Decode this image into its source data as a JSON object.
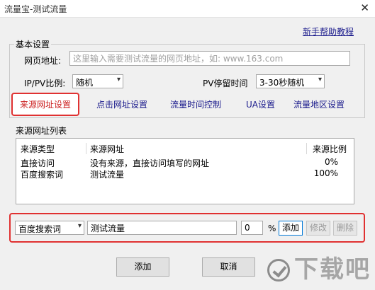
{
  "window": {
    "title": "流量宝-测试流量",
    "close_glyph": "✕"
  },
  "help_link": "新手帮助教程",
  "basic": {
    "group_label": "基本设置",
    "url_label": "网页地址:",
    "url_placeholder": "这里输入需要测试流量的网页地址，如: www.163.com",
    "ip_pv_label": "IP/PV比例:",
    "ip_pv_value": "随机",
    "pv_stay_label": "PV停留时间",
    "pv_stay_value": "3-30秒随机"
  },
  "tabs": [
    {
      "label": "来源网址设置",
      "active": true
    },
    {
      "label": "点击网址设置"
    },
    {
      "label": "流量时间控制"
    },
    {
      "label": "UA设置"
    },
    {
      "label": "流量地区设置"
    }
  ],
  "source_list": {
    "group_label": "来源网址列表",
    "columns": [
      "来源类型",
      "来源网址",
      "来源比例"
    ],
    "rows": [
      {
        "type": "直接访问",
        "url": "没有来源，直接访问填写的网址",
        "ratio": "0%"
      },
      {
        "type": "百度搜索词",
        "url": "测试流量",
        "ratio": "100%"
      }
    ]
  },
  "edit_row": {
    "type_value": "百度搜索词",
    "keyword_value": "测试流量",
    "ratio_value": "0",
    "percent": "%",
    "add": "添加",
    "modify": "修改",
    "delete": "删除"
  },
  "footer": {
    "add": "添加",
    "cancel": "取消"
  },
  "watermark": {
    "text": "下载吧"
  },
  "icons": {
    "chevron": "chevron-down-icon"
  },
  "colors": {
    "accent_red": "#e03131",
    "link_blue": "#1a1a8c"
  }
}
